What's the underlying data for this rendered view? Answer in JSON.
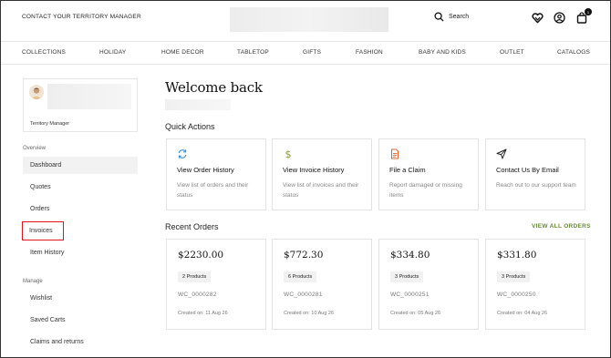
{
  "header": {
    "contact_label": "CONTACT YOUR TERRITORY MANAGER",
    "search_label": "Search",
    "cart_count": "1"
  },
  "nav": {
    "items": [
      "COLLECTIONS",
      "HOLIDAY",
      "HOME DECOR",
      "TABLETOP",
      "GIFTS",
      "FASHION",
      "BABY AND KIDS",
      "OUTLET",
      "CATALOGS"
    ]
  },
  "sidebar": {
    "role": "Territory Manager",
    "overview_label": "Overview",
    "overview_items": [
      "Dashboard",
      "Quotes",
      "Orders",
      "Invoices",
      "Item History"
    ],
    "manage_label": "Manage",
    "manage_items": [
      "Wishlist",
      "Saved Carts",
      "Claims and returns"
    ]
  },
  "main": {
    "welcome": "Welcome back",
    "quick_actions_title": "Quick Actions",
    "quick_actions": [
      {
        "icon": "refresh-icon",
        "title": "View Order History",
        "desc": "View list of orders and their status"
      },
      {
        "icon": "dollar-icon",
        "title": "View Invoice History",
        "desc": "View list of invoices and their status"
      },
      {
        "icon": "document-icon",
        "title": "File a Claim",
        "desc": "Report damaged or missing items"
      },
      {
        "icon": "send-icon",
        "title": "Contact Us By Email",
        "desc": "Reach out to our support team"
      }
    ],
    "recent_orders_title": "Recent Orders",
    "view_all_label": "VIEW ALL ORDERS",
    "orders": [
      {
        "amount": "$2230.00",
        "products": "2 Products",
        "id": "WC_0000282",
        "created": "Created on: 11 Aug 26"
      },
      {
        "amount": "$772.30",
        "products": "6 Products",
        "id": "WC_0000281",
        "created": "Created on: 10 Aug 26"
      },
      {
        "amount": "$334.80",
        "products": "3 Products",
        "id": "WC_0000251",
        "created": "Created on: 05 Aug 26"
      },
      {
        "amount": "$331.80",
        "products": "3 Products",
        "id": "WC_0000250",
        "created": "Created on: 04 Aug 26"
      }
    ]
  },
  "colors": {
    "accent_green": "#6a8a3c",
    "highlight_red": "#e0141a",
    "icon_blue": "#3a8fd6",
    "icon_olive": "#8a9a2a",
    "icon_orange": "#e0622a"
  }
}
